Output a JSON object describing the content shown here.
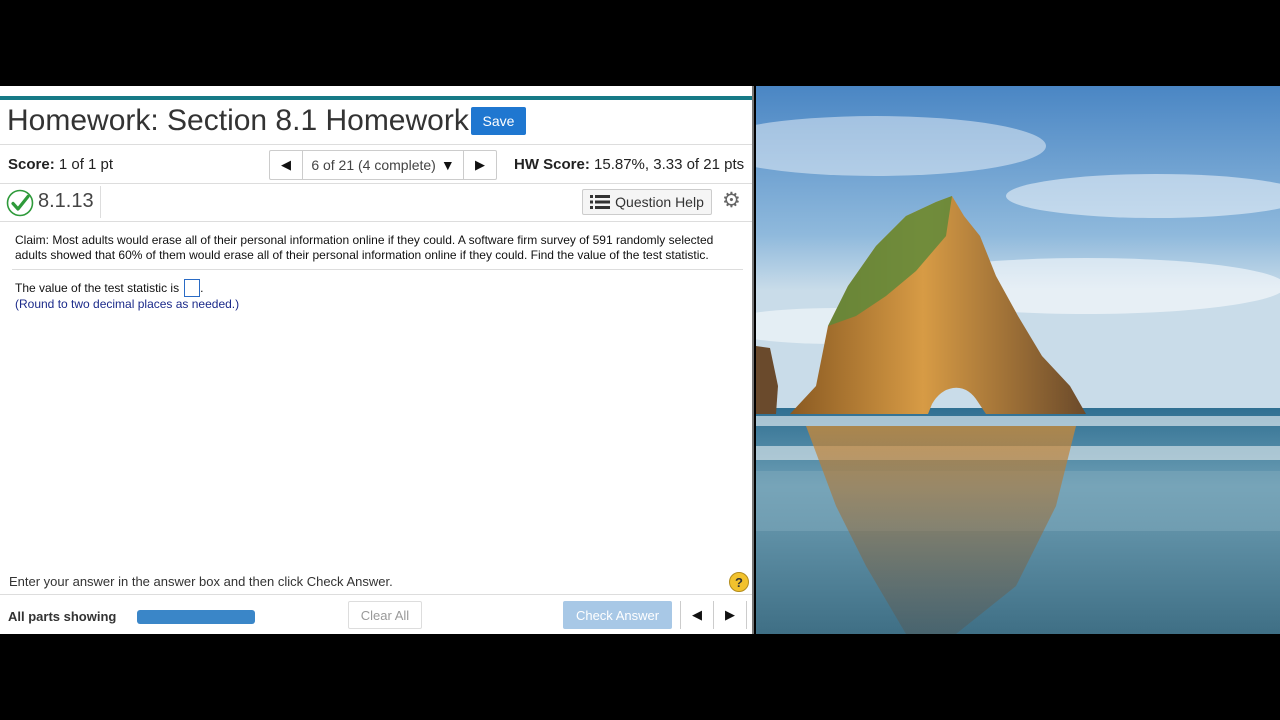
{
  "header": {
    "title": "Homework: Section 8.1 Homework",
    "save_label": "Save"
  },
  "score_row": {
    "score_label": "Score:",
    "score_value": "1 of 1 pt",
    "nav_position": "6 of 21 (4 complete)",
    "hw_score_label": "HW Score:",
    "hw_score_value": "15.87%, 3.33 of 21 pts"
  },
  "question": {
    "number": "8.1.13",
    "help_label": "Question Help",
    "claim": "Claim: Most adults would erase all of their personal information online if they could. A software firm survey of 591 randomly selected adults showed that 60% of them would erase all of their personal information online if they could. Find the value of the test statistic.",
    "statement": "The value of the test statistic is",
    "hint": "(Round to two decimal places as needed.)"
  },
  "footer": {
    "message": "Enter your answer in the answer box and then click Check Answer.",
    "help_glyph": "?",
    "parts_label": "All parts showing",
    "progress": 1.0,
    "clear_label": "Clear All",
    "check_label": "Check Answer"
  },
  "colors": {
    "accent_bar": "#167a86",
    "save_button": "#1f77d0",
    "check_button_disabled": "#a8c8e6",
    "progress_fill": "#3a86c8"
  },
  "icons": {
    "prev": "triangle-left-icon",
    "next": "triangle-right-icon",
    "dropdown": "triangle-down-icon",
    "correct": "check-circle-icon",
    "list": "list-icon",
    "settings": "gear-icon",
    "help": "question-circle-icon"
  }
}
